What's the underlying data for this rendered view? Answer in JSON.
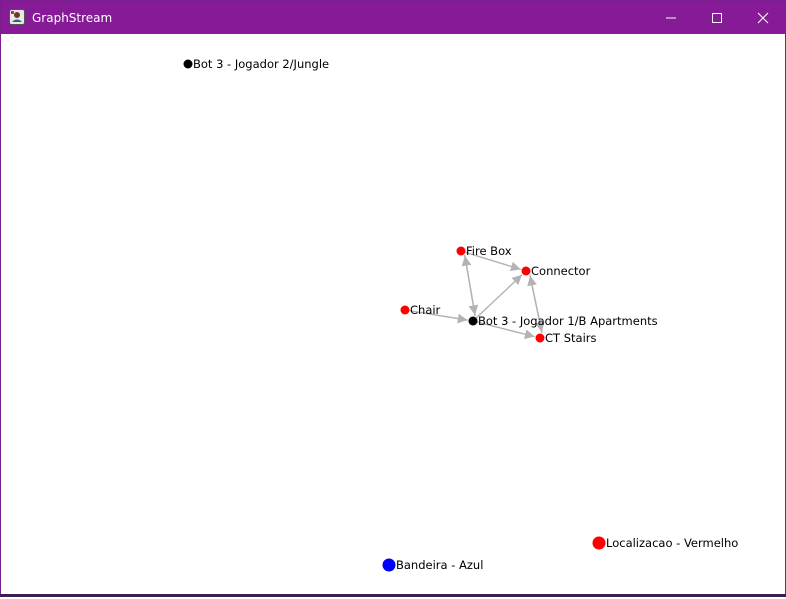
{
  "window": {
    "title": "GraphStream",
    "titlebar_color": "#861a97",
    "controls": {
      "minimize": "minimize-icon",
      "maximize": "maximize-icon",
      "close": "close-icon"
    }
  },
  "graph": {
    "edge_color": "#b3b3b3",
    "nodes": [
      {
        "id": "jungle",
        "label": "Bot 3 - Jogador 2/Jungle",
        "color": "#000000"
      },
      {
        "id": "firebox",
        "label": "Fire Box",
        "color": "#ff0000"
      },
      {
        "id": "connector",
        "label": "Connector",
        "color": "#ff0000"
      },
      {
        "id": "chair",
        "label": "Chair",
        "color": "#ff0000"
      },
      {
        "id": "bot1",
        "label": "Bot 3 - Jogador 1/B Apartments",
        "color": "#000000"
      },
      {
        "id": "ctstairs",
        "label": "CT Stairs",
        "color": "#ff0000"
      },
      {
        "id": "vermelho",
        "label": "Localizacao - Vermelho",
        "color": "#ff0000"
      },
      {
        "id": "azul",
        "label": "Bandeira - Azul",
        "color": "#0000ff"
      }
    ],
    "edges": [
      {
        "from": "firebox",
        "to": "connector"
      },
      {
        "from": "firebox",
        "to": "bot1"
      },
      {
        "from": "bot1",
        "to": "firebox"
      },
      {
        "from": "bot1",
        "to": "connector"
      },
      {
        "from": "chair",
        "to": "bot1"
      },
      {
        "from": "bot1",
        "to": "ctstairs"
      },
      {
        "from": "ctstairs",
        "to": "connector"
      },
      {
        "from": "connector",
        "to": "ctstairs"
      }
    ]
  }
}
